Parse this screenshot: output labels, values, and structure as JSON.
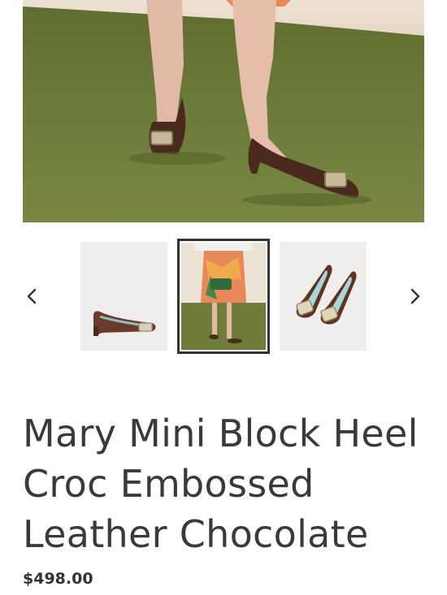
{
  "product": {
    "title": "Mary Mini Block Heel Croc Embossed Leather Chocolate",
    "price": "$498.00"
  },
  "gallery": {
    "thumbnails": [
      {
        "label": "side-view"
      },
      {
        "label": "model-view",
        "selected": true
      },
      {
        "label": "top-view"
      }
    ]
  },
  "icons": {
    "prev": "chevron-left-icon",
    "next": "chevron-right-icon"
  },
  "colors": {
    "text": "#333333",
    "grass": "#6b7a3a",
    "shoe": "#4a2a1e"
  }
}
